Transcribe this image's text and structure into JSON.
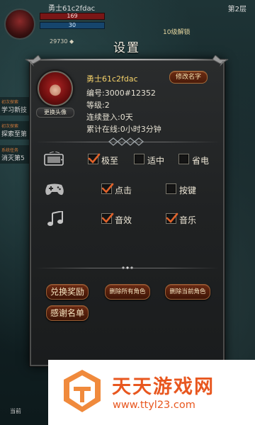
{
  "background": {
    "player_name": "勇士61c2fdac",
    "hp_text": "169",
    "mp_text": "30",
    "top_right_text": "第2层",
    "event_text": "10级解锁",
    "coins_text": "29730 ◆",
    "side_quests": [
      {
        "tag": "初次探索",
        "label": "学习新技"
      },
      {
        "tag": "初次探索",
        "label": "探索至第"
      },
      {
        "tag": "系统任务",
        "label": "消灭第5"
      }
    ],
    "bottom_label": "当前"
  },
  "settings": {
    "title": "设置",
    "profile": {
      "name": "勇士61c2fdac",
      "id_line": "编号:3000#12352",
      "level_line": "等级:2",
      "login_line": "连续登入:0天",
      "online_line": "累计在线:0小时3分钟",
      "change_avatar_label": "更换头像",
      "rename_label": "修改名字"
    },
    "quality_row": {
      "icon": "device-icon",
      "options": [
        {
          "label": "极至",
          "checked": true
        },
        {
          "label": "适中",
          "checked": false
        },
        {
          "label": "省电",
          "checked": false
        }
      ]
    },
    "control_row": {
      "icon": "gamepad-icon",
      "options": [
        {
          "label": "点击",
          "checked": true
        },
        {
          "label": "按键",
          "checked": false
        }
      ]
    },
    "sound_row": {
      "icon": "music-note-icon",
      "options": [
        {
          "label": "音效",
          "checked": true
        },
        {
          "label": "音乐",
          "checked": true
        }
      ]
    },
    "buttons": {
      "redeem": "兑换奖励",
      "delete_all": "删除所有角色",
      "delete_current": "删除当前角色",
      "credits": "感谢名单"
    }
  },
  "watermark": {
    "cn": "天天游戏网",
    "url": "www.ttyl23.com"
  },
  "colors": {
    "accent_gold": "#f5d26a",
    "button_red": "#6a2a12",
    "watermark_orange": "#e8571f"
  }
}
